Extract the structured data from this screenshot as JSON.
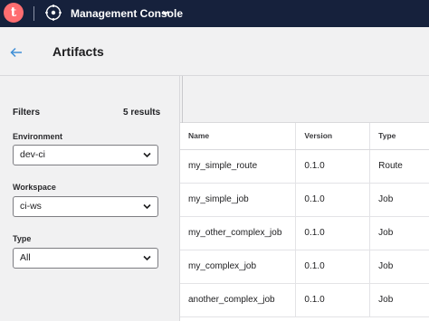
{
  "topbar": {
    "logo_letter": "t",
    "app_title": "Management Console",
    "compass_icon": "compass-icon",
    "chevron_icon": "chevron-down-icon"
  },
  "header": {
    "back_icon": "arrow-left-icon",
    "title": "Artifacts"
  },
  "filters": {
    "title": "Filters",
    "results": "5 results",
    "fields": [
      {
        "label": "Environment",
        "value": "dev-ci"
      },
      {
        "label": "Workspace",
        "value": "ci-ws"
      },
      {
        "label": "Type",
        "value": "All"
      }
    ]
  },
  "table": {
    "columns": [
      "Name",
      "Version",
      "Type"
    ],
    "rows": [
      {
        "name": "my_simple_route",
        "version": "0.1.0",
        "type": "Route"
      },
      {
        "name": "my_simple_job",
        "version": "0.1.0",
        "type": "Job"
      },
      {
        "name": "my_other_complex_job",
        "version": "0.1.0",
        "type": "Job"
      },
      {
        "name": "my_complex_job",
        "version": "0.1.0",
        "type": "Job"
      },
      {
        "name": "another_complex_job",
        "version": "0.1.0",
        "type": "Job"
      }
    ]
  },
  "colors": {
    "topbar_bg": "#16213c",
    "logo_bg": "#ff6d70",
    "accent": "#3f8fd6"
  }
}
